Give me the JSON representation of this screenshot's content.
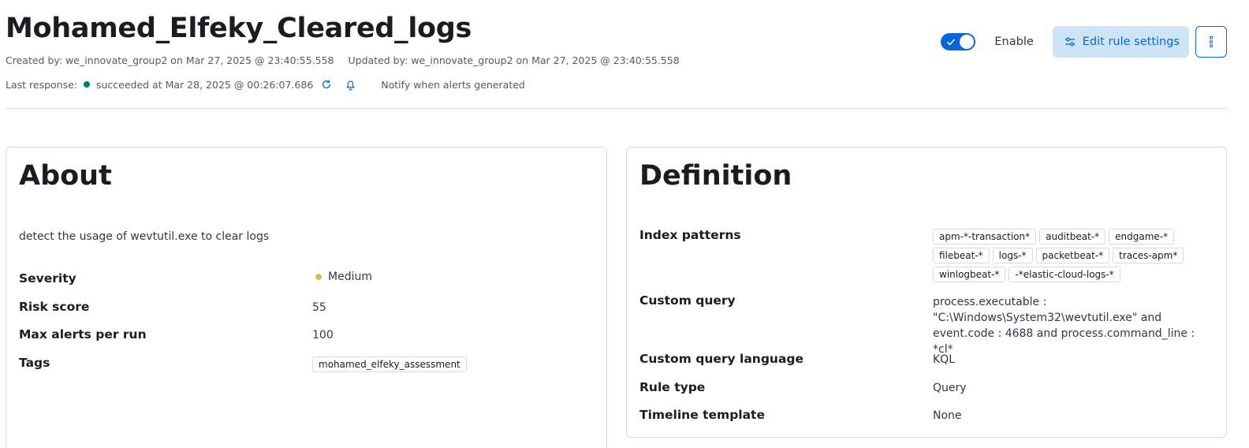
{
  "header": {
    "title": "Mohamed_Elfeky_Cleared_logs",
    "created": "Created by: we_innovate_group2 on Mar 27, 2025 @ 23:40:55.558",
    "updated": "Updated by: we_innovate_group2 on Mar 27, 2025 @ 23:40:55.558",
    "last_response_label": "Last response:",
    "last_response_value": "succeeded at Mar 28, 2025 @ 00:26:07.686",
    "notify_text": "Notify when alerts generated",
    "status_color": "#00806b"
  },
  "actions": {
    "enabled": true,
    "enable_label": "Enable",
    "edit_label": "Edit rule settings",
    "accent": "#0b64dd"
  },
  "about": {
    "title": "About",
    "description": "detect the usage of wevtutil.exe to clear logs",
    "severity_label": "Severity",
    "severity_value": "Medium",
    "severity_color": "#d6bf57",
    "risk_label": "Risk score",
    "risk_value": "55",
    "max_alerts_label": "Max alerts per run",
    "max_alerts_value": "100",
    "tags_label": "Tags",
    "tags": [
      "mohamed_elfeky_assessment"
    ]
  },
  "definition": {
    "title": "Definition",
    "index_label": "Index patterns",
    "index_patterns": [
      "apm-*-transaction*",
      "auditbeat-*",
      "endgame-*",
      "filebeat-*",
      "logs-*",
      "packetbeat-*",
      "traces-apm*",
      "winlogbeat-*",
      "-*elastic-cloud-logs-*"
    ],
    "query_label": "Custom query",
    "query_value": "process.executable : \"C:\\Windows\\System32\\wevtutil.exe\" and event.code : 4688 and process.command_line : *cl*",
    "query_lang_label": "Custom query language",
    "query_lang_value": "KQL",
    "rule_type_label": "Rule type",
    "rule_type_value": "Query",
    "timeline_label": "Timeline template",
    "timeline_value": "None"
  }
}
